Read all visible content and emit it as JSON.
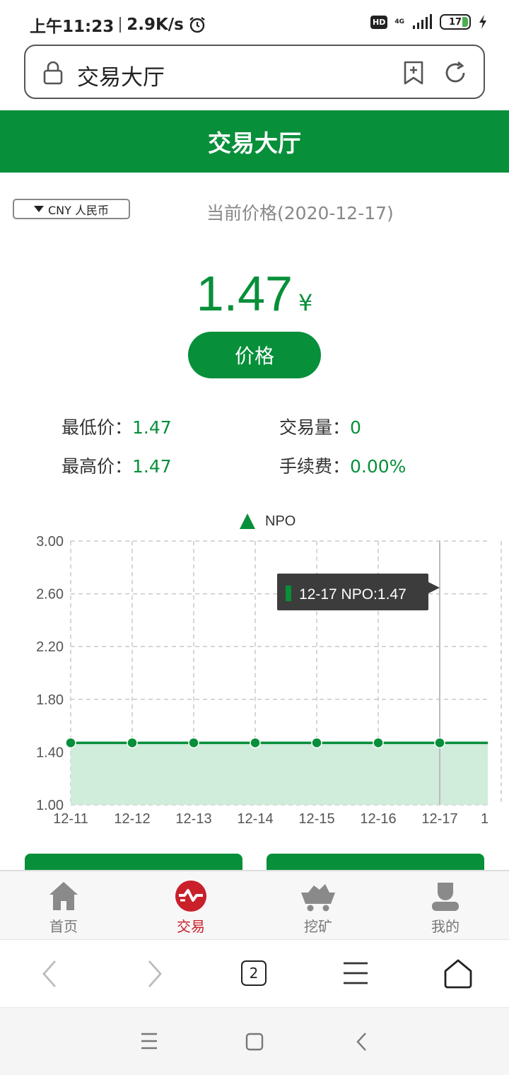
{
  "status": {
    "time": "上午11:23",
    "speed": "2.9K/s",
    "hd": "HD",
    "network": "4G",
    "battery": "17"
  },
  "browser": {
    "url_title": "交易大厅",
    "tab_count": "2"
  },
  "header": {
    "title": "交易大厅"
  },
  "currency": {
    "selected": "CNY 人民币"
  },
  "price": {
    "label": "当前价格(2020-12-17)",
    "value": "1.47",
    "unit": "¥",
    "button": "价格"
  },
  "stats": {
    "low_label": "最低价：",
    "low_value": "1.47",
    "high_label": "最高价：",
    "high_value": "1.47",
    "volume_label": "交易量：",
    "volume_value": "0",
    "fee_label": "手续费：",
    "fee_value": "0.00%"
  },
  "chart_data": {
    "type": "area",
    "categories": [
      "12-11",
      "12-12",
      "12-13",
      "12-14",
      "12-15",
      "12-16",
      "12-17"
    ],
    "series": [
      {
        "name": "NPO",
        "values": [
          1.47,
          1.47,
          1.47,
          1.47,
          1.47,
          1.47,
          1.47
        ]
      }
    ],
    "y_ticks": [
      "3.00",
      "2.60",
      "2.20",
      "1.80",
      "1.40",
      "1.00"
    ],
    "ylim": [
      1.0,
      3.0
    ],
    "tooltip": "12-17 NPO:1.47",
    "legend": "top-center",
    "grid": true,
    "color": "#078f3a",
    "fill": "#cdebd8"
  },
  "tabbar": {
    "items": [
      {
        "label": "首页",
        "icon": "home-icon"
      },
      {
        "label": "交易",
        "icon": "trade-icon"
      },
      {
        "label": "挖矿",
        "icon": "mining-cart-icon"
      },
      {
        "label": "我的",
        "icon": "user-icon"
      }
    ]
  }
}
